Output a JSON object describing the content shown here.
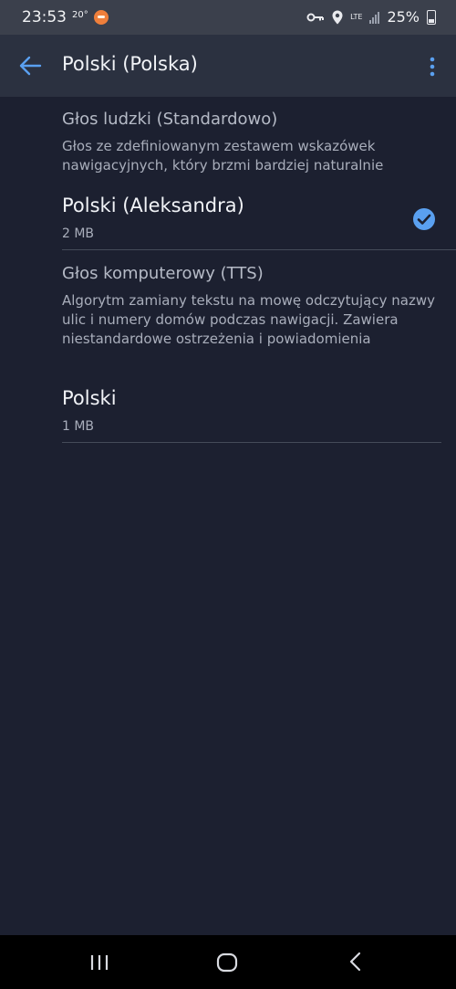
{
  "status_bar": {
    "time": "23:53",
    "temp": "20°",
    "network": "LTE",
    "battery": "25%"
  },
  "app_bar": {
    "title": "Polski (Polska)"
  },
  "sections": {
    "human": {
      "title": "Głos ludzki (Standardowo)",
      "description": "Głos ze zdefiniowanym zestawem wskazówek nawigacyjnych, który brzmi bardziej naturalnie"
    },
    "computer": {
      "title": "Głos komputerowy (TTS)",
      "description": "Algorytm zamiany tekstu na mowę odczytujący nazwy ulic i numery domów podczas nawigacji. Zawiera niestandardowe ostrzeżenia i powiadomienia"
    }
  },
  "voices": [
    {
      "name": "Polski (Aleksandra)",
      "size": "2 MB",
      "selected": true
    },
    {
      "name": "Polski",
      "size": "1 MB",
      "selected": false
    }
  ],
  "colors": {
    "accent": "#5aa0f0",
    "background": "#1c2030",
    "app_bar": "#2b3140"
  },
  "icons": {
    "back": "arrow-left-icon",
    "menu": "more-vert-icon",
    "selected": "check-circle-icon"
  }
}
